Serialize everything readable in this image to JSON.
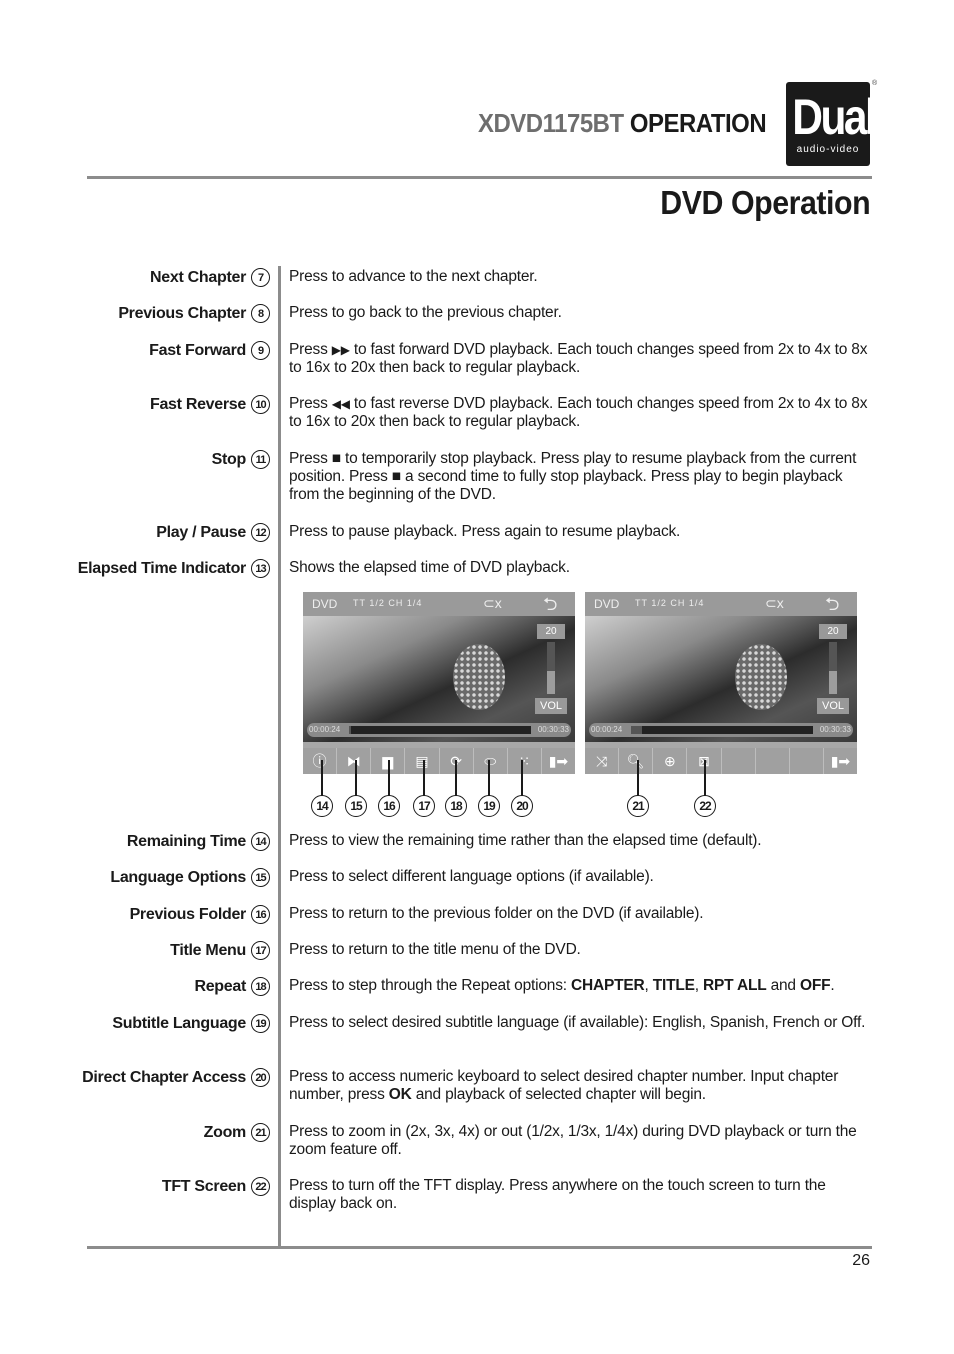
{
  "header": {
    "model": "XDVD1175BT",
    "section": "OPERATION",
    "logo_main": "Dual",
    "logo_sub": "audio-video",
    "logo_reg": "®"
  },
  "page_title": "DVD Operation",
  "page_number": "26",
  "items_top": [
    {
      "label": "Next Chapter",
      "num": "7",
      "desc": "Press to advance to the next chapter."
    },
    {
      "label": "Previous Chapter",
      "num": "8",
      "desc": "Press to go back to the previous chapter."
    },
    {
      "label": "Fast Forward",
      "num": "9",
      "desc_pre": "Press ",
      "icon": "fast-forward-icon",
      "glyph": "▶▶",
      "desc": " to fast forward DVD playback. Each touch changes speed from 2x to 4x to 8x to 16x to 20x then back to regular playback."
    },
    {
      "label": "Fast Reverse",
      "num": "10",
      "desc_pre": "Press ",
      "icon": "fast-reverse-icon",
      "glyph": "◀◀",
      "desc": "  to fast reverse DVD playback. Each touch changes speed from 2x to 4x to 8x to 16x to 20x then back to regular playback."
    },
    {
      "label": "Stop",
      "num": "11",
      "desc_a": "Press ",
      "glyph": "■",
      "desc_b": " to temporarily stop playback. Press play to resume playback from the current position. Press ",
      "desc_c": " a second time to fully stop playback. Press play to begin playback from the beginning of the DVD."
    },
    {
      "label": "Play / Pause",
      "num": "12",
      "desc": "Press to pause playback. Press again to resume playback."
    },
    {
      "label": "Elapsed Time Indicator",
      "num": "13",
      "desc": "Shows the elapsed time of DVD playback."
    }
  ],
  "screens": [
    {
      "source": "DVD",
      "track_info": "TT  1/2  CH  1/4",
      "swap_glyph": "⊂x",
      "back_glyph": "⮌",
      "volume": "20",
      "volume_level_fraction": 0.45,
      "vol_label": "VOL",
      "elapsed": "00:00:24",
      "total": "00:30:33",
      "progress_fraction": 0.01,
      "buttons": [
        {
          "name": "remaining-time",
          "glyph": "ⓘ"
        },
        {
          "name": "language-options",
          "glyph": "⧓"
        },
        {
          "name": "previous-folder",
          "glyph": "▆"
        },
        {
          "name": "title-menu",
          "glyph": "▤"
        },
        {
          "name": "repeat",
          "glyph": "⟳"
        },
        {
          "name": "subtitle-language",
          "glyph": "⬭"
        },
        {
          "name": "direct-chapter-access",
          "glyph": "⁙"
        },
        {
          "name": "next-page",
          "glyph": "▮➡"
        }
      ]
    },
    {
      "source": "DVD",
      "track_info": "TT  1/2  CH  1/4",
      "swap_glyph": "⊂x",
      "back_glyph": "⮌",
      "volume": "20",
      "volume_level_fraction": 0.45,
      "vol_label": "VOL",
      "elapsed": "00:00:24",
      "total": "00:30:33",
      "progress_fraction": 0.06,
      "buttons": [
        {
          "name": "shuffle",
          "glyph": "⤨"
        },
        {
          "name": "zoom",
          "glyph": "🔍︎"
        },
        {
          "name": "search",
          "glyph": "⊕"
        },
        {
          "name": "tft-screen",
          "glyph": "⊠"
        },
        {
          "name": "empty-1",
          "glyph": ""
        },
        {
          "name": "empty-2",
          "glyph": ""
        },
        {
          "name": "empty-3",
          "glyph": ""
        },
        {
          "name": "prev-page",
          "glyph": "▮➡"
        }
      ]
    }
  ],
  "callouts": [
    "14",
    "15",
    "16",
    "17",
    "18",
    "19",
    "20",
    "21",
    "22"
  ],
  "items_bottom": [
    {
      "label": "Remaining Time",
      "num": "14",
      "desc": "Press to view the remaining time rather than the elapsed time (default)."
    },
    {
      "label": "Language Options",
      "num": "15",
      "desc": "Press to select different language options (if available)."
    },
    {
      "label": "Previous Folder",
      "num": "16",
      "desc": "Press to return to the previous folder on the DVD (if available)."
    },
    {
      "label": "Title Menu",
      "num": "17",
      "desc": "Press to return to the title menu of the DVD."
    },
    {
      "label": "Repeat",
      "num": "18",
      "desc_pre": "Press to step through the Repeat options: ",
      "opt1": "CHAPTER",
      "sep1": ", ",
      "opt2": "TITLE",
      "sep2": ", ",
      "opt3": "RPT ALL",
      "sep3": " and ",
      "opt4": "OFF",
      "end": "."
    },
    {
      "label": "Subtitle Language",
      "num": "19",
      "desc": "Press to select desired subtitle language (if available): English, Spanish, French or Off."
    },
    {
      "label": "Direct Chapter Access",
      "num": "20",
      "desc_pre": "Press to access numeric keyboard to select desired chapter number. Input chapter number, press ",
      "bold": "OK",
      "desc_post": " and playback of selected chapter will begin."
    },
    {
      "label": "Zoom",
      "num": "21",
      "desc": "Press to zoom in (2x, 3x, 4x) or out (1/2x, 1/3x, 1/4x) during DVD playback or turn the zoom feature off."
    },
    {
      "label": "TFT Screen",
      "num": "22",
      "desc": "Press to turn off the TFT display. Press anywhere on the touch screen to turn the display back on."
    }
  ]
}
